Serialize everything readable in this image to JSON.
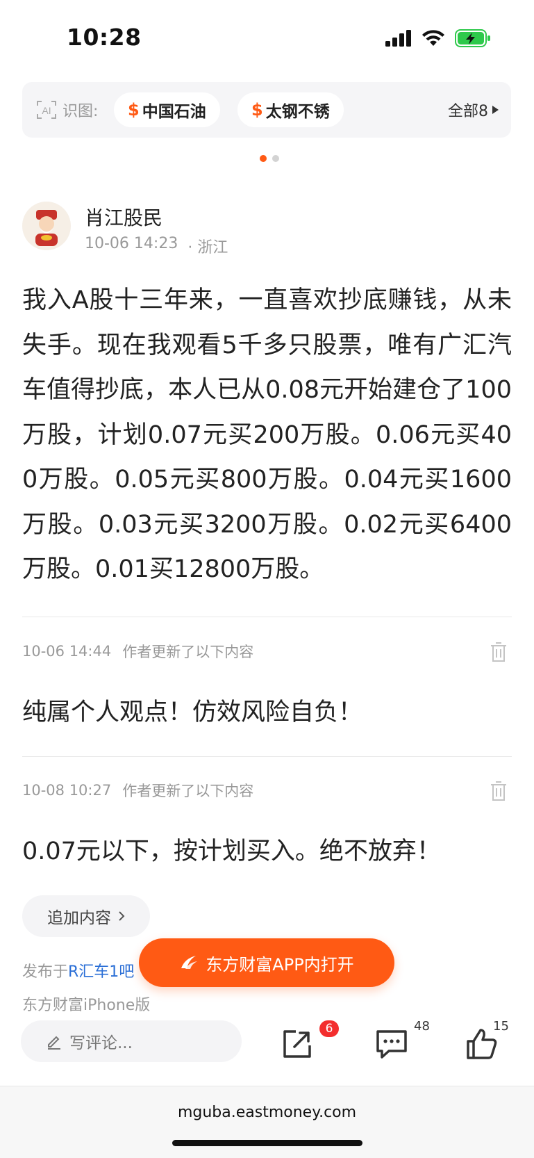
{
  "status_bar": {
    "time": "10:28"
  },
  "ai_bar": {
    "label": "识图:",
    "chips": [
      {
        "symbol": "$",
        "name": "中国石油"
      },
      {
        "symbol": "$",
        "name": "太钢不锈"
      }
    ],
    "all_label": "全部8"
  },
  "author": {
    "name": "肖江股民",
    "time": "10-06 14:23",
    "location": "· 浙江"
  },
  "post": {
    "body": "我入A股十三年来，一直喜欢抄底赚钱，从未失手。现在我观看5千多只股票，唯有广汇汽车值得抄底，本人已从0.08元开始建仓了100万股，计划0.07元买200万股。0.06元买400万股。0.05元买800万股。0.04元买1600万股。0.03元买3200万股。0.02元买6400万股。0.01买12800万股。"
  },
  "updates": [
    {
      "time": "10-06 14:44",
      "note": "作者更新了以下内容",
      "text": "纯属个人观点！仿效风险自负！"
    },
    {
      "time": "10-08 10:27",
      "note": "作者更新了以下内容",
      "text": "0.07元以下，按计划买入。绝不放弃！"
    }
  ],
  "append_label": "追加内容",
  "publish": {
    "prefix": "发布于",
    "bar": "R汇车1吧",
    "client": "东方财富iPhone版"
  },
  "open_app_label": "东方财富APP内打开",
  "actions": {
    "comment_placeholder": "写评论...",
    "share_badge": "6",
    "comment_count": "48",
    "like_count": "15"
  },
  "browser": {
    "url": "mguba.eastmoney.com"
  },
  "colors": {
    "accent": "#ff5a14",
    "link": "#2b6fd6",
    "badge": "#f32e2e"
  }
}
